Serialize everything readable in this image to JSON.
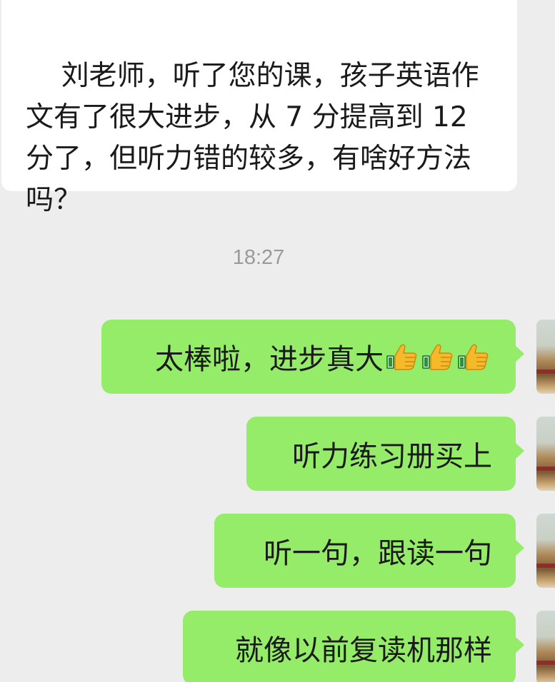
{
  "incoming": {
    "text": "刘老师，听了您的课，孩子英语作文有了很大进步，从 7 分提高到 12 分了，但听力错的较多，有啥好方法吗？"
  },
  "timestamp": "18:27",
  "outgoing": [
    {
      "text": "太棒啦，进步真大",
      "emoji": "thumbs-up-icon ×3"
    },
    {
      "text": "听力练习册买上"
    },
    {
      "text": "听一句，跟读一句"
    },
    {
      "text": "就像以前复读机那样"
    }
  ],
  "colors": {
    "background": "#ededed",
    "incoming_bubble": "#ffffff",
    "outgoing_bubble": "#95ec69",
    "timestamp": "#9a9a9a"
  }
}
